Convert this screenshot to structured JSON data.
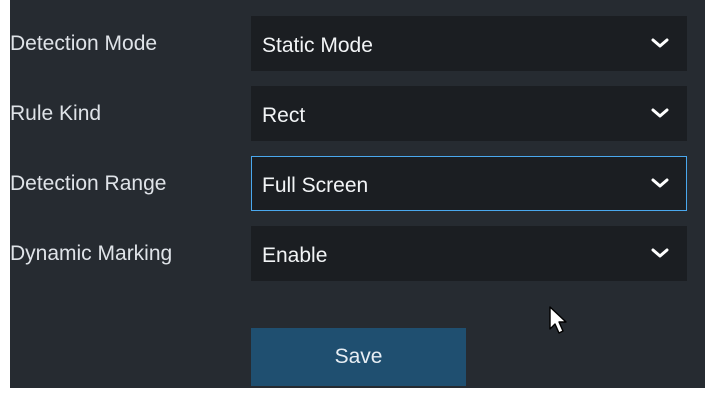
{
  "form": {
    "rows": [
      {
        "label": "Detection Mode",
        "value": "Static Mode"
      },
      {
        "label": "Rule Kind",
        "value": "Rect"
      },
      {
        "label": "Detection Range",
        "value": "Full Screen"
      },
      {
        "label": "Dynamic Marking",
        "value": "Enable"
      }
    ],
    "save_label": "Save"
  },
  "icons": {
    "dropdown": "chevron-down-icon",
    "pointer": "mouse-pointer-icon"
  },
  "colors": {
    "panel_bg": "#262b31",
    "field_bg": "#1b1e22",
    "focus_border": "#4aa8ee",
    "button_bg": "#1f4f70",
    "text": "#dfe3e8"
  }
}
